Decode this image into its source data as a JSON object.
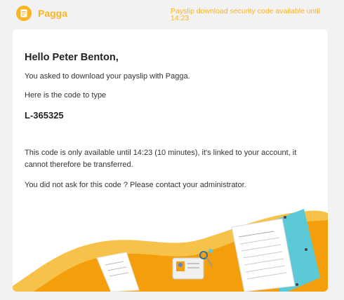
{
  "header": {
    "brand": "Pagga",
    "note": "Payslip download security code available until 14:23"
  },
  "email": {
    "greeting": "Hello Peter Benton,",
    "intro": "You asked to download your payslip with Pagga.",
    "instruction": "Here is the code to type",
    "code": "L-365325",
    "availability": "This code is only available until 14:23 (10 minutes), it's linked to your account, it cannot therefore be transferred.",
    "contact": "You did not ask for this code ? Please contact your administrator."
  },
  "colors": {
    "accent": "#f8b526",
    "orange": "#f59e0b",
    "teal": "#5bc9d6",
    "background": "#f2f2f3"
  }
}
